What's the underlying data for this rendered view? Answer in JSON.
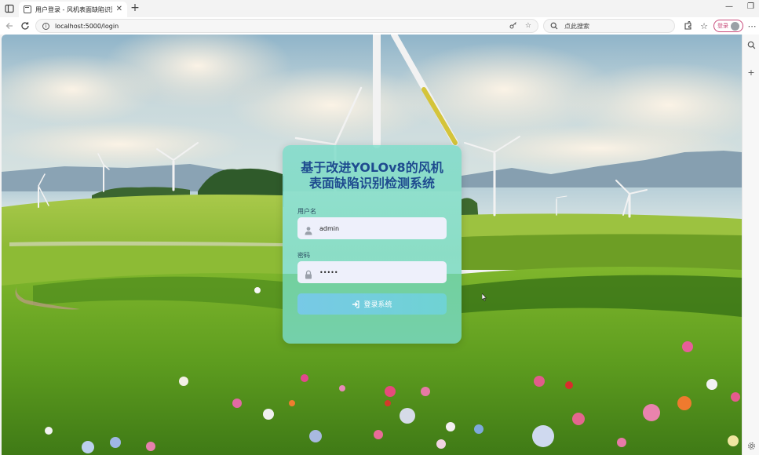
{
  "browser": {
    "tab": {
      "title": "用户登录 - 风机表面缺陷识别检测系统"
    },
    "address_bar": {
      "url": "localhost:5000/login"
    },
    "search_box": {
      "placeholder": "点此搜索"
    },
    "profile": {
      "login_label": "登录"
    }
  },
  "login_card": {
    "title_line1": "基于改进YOLOv8的风机",
    "title_line2": "表面缺陷识别检测系统",
    "username": {
      "label": "用户名",
      "value": "admin",
      "icon": "user-icon"
    },
    "password": {
      "label": "密码",
      "value": "•••••",
      "icon": "lock-icon"
    },
    "submit": {
      "label": "登录系统",
      "icon": "sign-in-icon"
    }
  },
  "colors": {
    "title": "#1e4b8f",
    "card": "#78dcc8",
    "button_start": "#77c9e6",
    "button_end": "#6fd3d3",
    "profile_accent": "#c84a7a"
  }
}
